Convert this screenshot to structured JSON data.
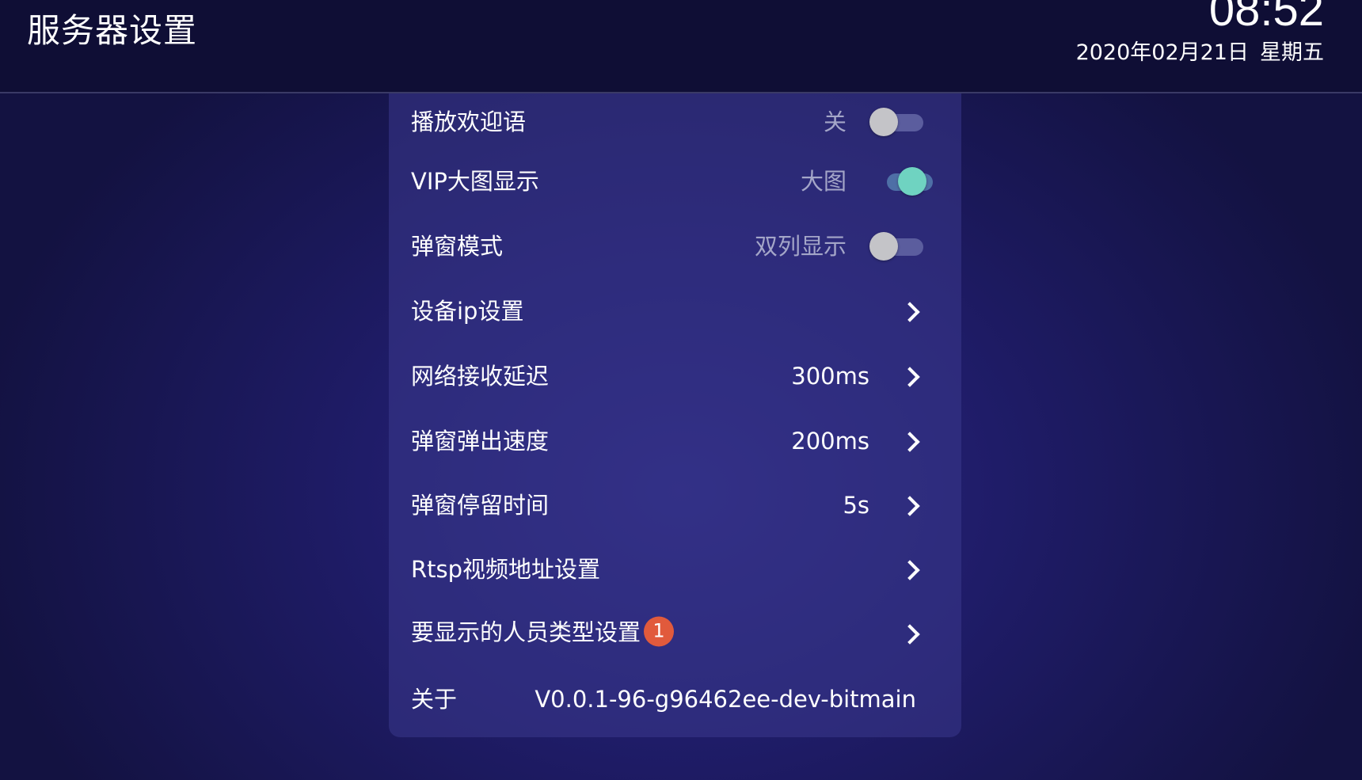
{
  "header": {
    "title": "服务器设置",
    "time": "08:52",
    "date": "2020年02月21日",
    "weekday": "星期五"
  },
  "settings": [
    {
      "label": "播放欢迎语",
      "value": "关",
      "control": "toggle",
      "state": "off"
    },
    {
      "label": "VIP大图显示",
      "value": "大图",
      "control": "toggle",
      "state": "on"
    },
    {
      "label": "弹窗模式",
      "value": "双列显示",
      "control": "toggle",
      "state": "off"
    },
    {
      "label": "设备ip设置",
      "value": "",
      "control": "chevron-right-icon"
    },
    {
      "label": "网络接收延迟",
      "value": "300ms",
      "control": "chevron-right-icon"
    },
    {
      "label": "弹窗弹出速度",
      "value": "200ms",
      "control": "chevron-right-icon"
    },
    {
      "label": "弹窗停留时间",
      "value": "5s",
      "control": "chevron-right-icon"
    },
    {
      "label": "Rtsp视频地址设置",
      "value": "",
      "control": "chevron-right-icon"
    },
    {
      "label": "要显示的人员类型设置",
      "badge": "1",
      "value": "",
      "control": "chevron-right-icon"
    },
    {
      "label": "关于",
      "value": "V0.0.1-96-g96462ee-dev-bitmain",
      "control": "none"
    }
  ],
  "colors": {
    "header_bg": "#0f0e35",
    "panel_bg": "#2e2c7a",
    "toggle_on": "#6fd3c1",
    "toggle_off": "#c4c4c8",
    "badge": "#e15a3c",
    "muted_text": "#a4a6c8"
  }
}
